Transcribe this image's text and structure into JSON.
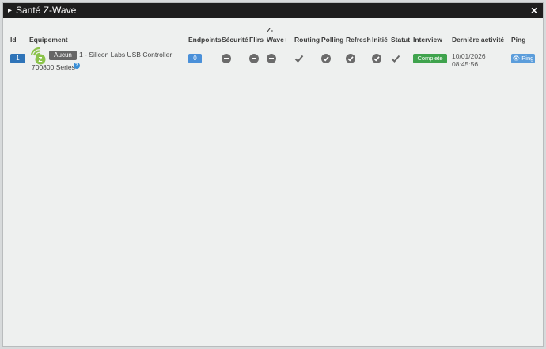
{
  "modal": {
    "title": "Santé Z-Wave",
    "close_label": "×"
  },
  "table": {
    "headers": {
      "id": "Id",
      "equipement": "Equipement",
      "endpoints": "Endpoints",
      "securite": "Sécurité",
      "flirs": "Flirs",
      "zwave_plus_1": "Z-",
      "zwave_plus_2": "Wave+",
      "routing": "Routing",
      "polling": "Polling",
      "refresh": "Refresh",
      "initie": "Initié",
      "statut": "Statut",
      "interview": "Interview",
      "derniere_activite": "Dernière activité",
      "ping": "Ping"
    },
    "rows": [
      {
        "id": "1",
        "group_badge": "Aucun",
        "name_line1": "1 - Silicon Labs USB Controller",
        "name_line2": "700800 Series",
        "help": "?",
        "endpoints": "0",
        "securite_icon": "minus-circle-icon",
        "flirs_icon": "minus-circle-icon",
        "zwave_plus_icon": "minus-circle-icon",
        "routing_icon": "check-icon",
        "polling_icon": "check-circle-icon",
        "refresh_icon": "check-circle-icon",
        "initie_icon": "check-circle-icon",
        "statut_icon": "check-icon",
        "interview": "Complete",
        "last_date": "10/01/2026",
        "last_time": "08:45:56",
        "ping_label": "Ping"
      }
    ]
  },
  "colors": {
    "title_bg": "#1e1e1e",
    "modal_bg": "#eef0ef",
    "id_badge": "#2f74b8",
    "endpoints_badge": "#4a90d9",
    "complete_badge": "#3fa34d",
    "ping_button": "#5b9ddb",
    "group_badge": "#666666",
    "zwave_logo": "#8bc34a"
  }
}
